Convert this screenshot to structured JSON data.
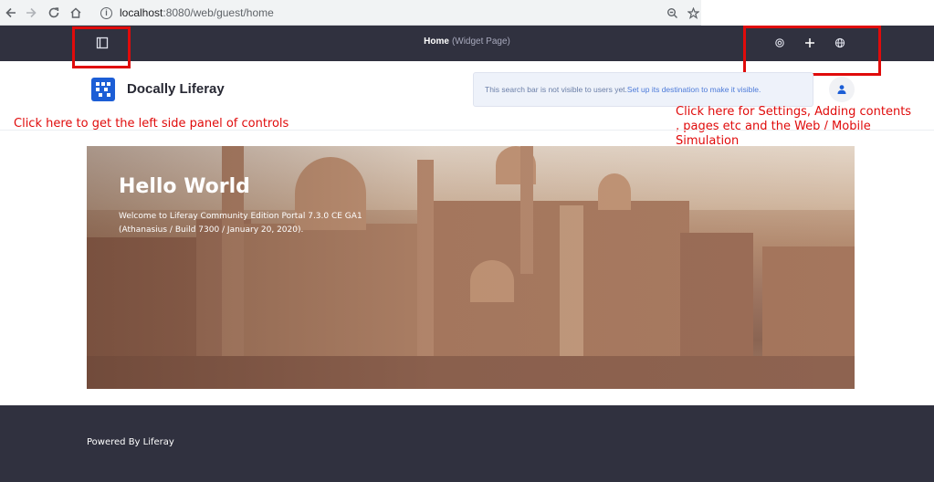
{
  "browser": {
    "url_host": "localhost",
    "url_path": ":8080/web/guest/home",
    "back_icon": "arrow-left-icon",
    "forward_icon": "arrow-right-icon",
    "reload_icon": "reload-icon",
    "home_icon": "home-icon",
    "zoom_icon": "magnifier-icon",
    "bookmark_icon": "star-icon"
  },
  "control_menu": {
    "page_title": "Home",
    "page_subtitle": "(Widget Page)",
    "toggle_icon": "sidebar-toggle-icon",
    "settings_icon": "gear-icon",
    "add_icon": "plus-icon",
    "simulation_icon": "globe-icon",
    "background": "#30313f"
  },
  "header": {
    "site_name": "Docally Liferay",
    "search_notice_text": "This search bar is not visible to users yet. ",
    "search_notice_link": "Set up its destination to make it visible.",
    "logo_color": "#1c5ed6"
  },
  "annotations": {
    "left_panel": "Click here to get the left side panel of controls",
    "settings_line1": "Click here for Settings, Adding contents",
    "settings_line2": ", pages etc and the Web / Mobile",
    "settings_line3": "Simulation",
    "color": "#e00b0b"
  },
  "banner": {
    "heading": "Hello World",
    "welcome_line1": "Welcome to Liferay Community Edition Portal 7.3.0 CE GA1",
    "welcome_line2": "(Athanasius / Build 7300 / January 20, 2020)."
  },
  "footer": {
    "text": "Powered By Liferay"
  }
}
